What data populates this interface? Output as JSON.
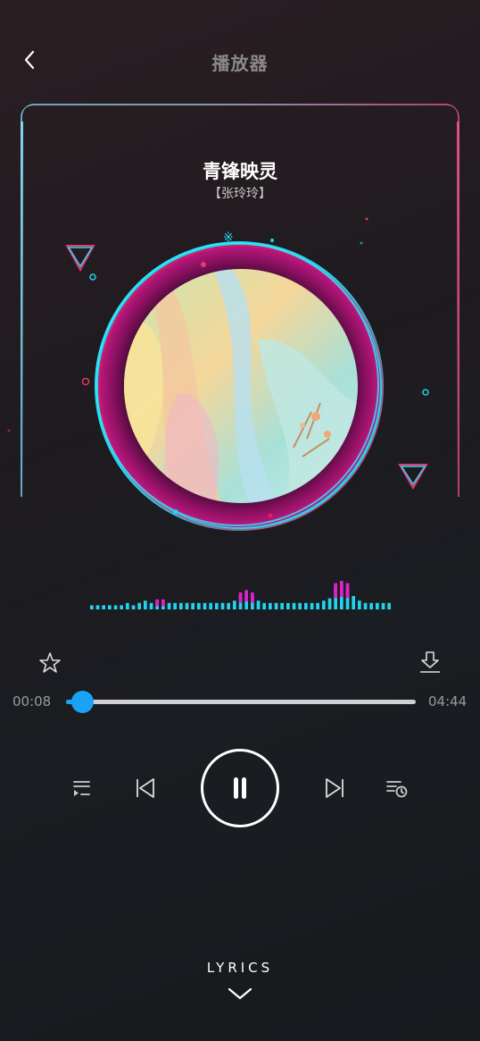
{
  "header": {
    "title": "播放器",
    "back_icon": "chevron-left-icon"
  },
  "song": {
    "title": "青锋映灵",
    "artist": "【张玲玲】"
  },
  "playback": {
    "current_time": "00:08",
    "total_time": "04:44",
    "progress": 0.03,
    "state": "playing"
  },
  "actions": {
    "favorite_icon": "star-icon",
    "download_icon": "download-icon"
  },
  "controls": [
    "playlist-icon",
    "previous-icon",
    "pause-icon",
    "next-icon",
    "history-icon"
  ],
  "lyrics": {
    "label": "LYRICS",
    "icon": "chevron-down-icon"
  },
  "colors": {
    "accent": "#1aa3f5",
    "cyan": "#22d3ee",
    "magenta": "#e020c8"
  },
  "visualizer": {
    "bars": [
      1,
      1,
      1,
      1,
      1,
      1,
      2,
      1,
      2,
      3,
      2,
      2,
      2,
      2,
      2,
      2,
      2,
      2,
      2,
      2,
      2,
      2,
      2,
      2,
      3,
      5,
      6,
      5,
      3,
      2,
      2,
      2,
      2,
      2,
      2,
      2,
      2,
      2,
      2,
      3,
      4,
      9,
      10,
      9,
      5,
      3,
      2,
      2,
      2,
      2,
      2
    ],
    "magenta_bars": [
      11,
      12,
      25,
      26,
      27,
      41,
      42,
      43
    ]
  }
}
